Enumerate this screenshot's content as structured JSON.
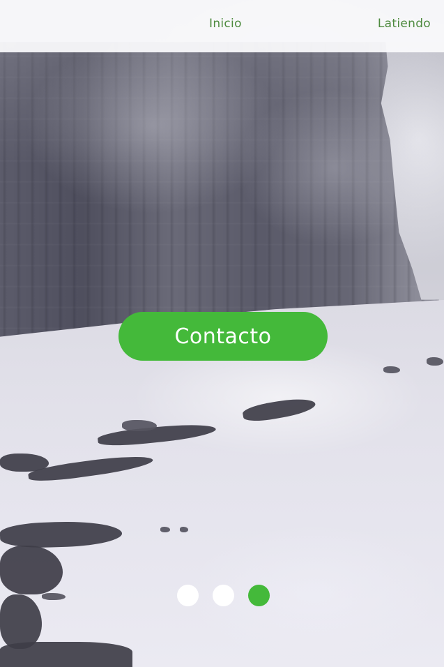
{
  "nav": {
    "items": [
      {
        "label": "Inicio"
      },
      {
        "label": "Latiendo"
      }
    ]
  },
  "hero": {
    "cta_label": "Contacto",
    "image_alt": "Snowy glacier field beneath a foggy cliff"
  },
  "carousel": {
    "slide_count": 3,
    "active_index": 2
  },
  "colors": {
    "accent": "#44b93a",
    "nav_text": "#4d8a3e",
    "dot_inactive": "#ffffff"
  }
}
